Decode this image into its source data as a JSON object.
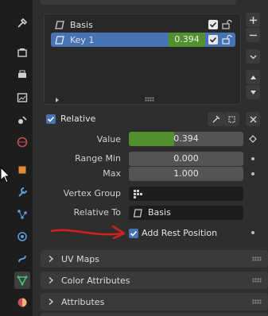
{
  "shape_keys": {
    "items": [
      {
        "name": "Basis",
        "value": "",
        "enabled": true,
        "selected": false
      },
      {
        "name": "Key 1",
        "value": "0.394",
        "enabled": true,
        "selected": true
      }
    ]
  },
  "options": {
    "relative_label": "Relative",
    "relative_checked": true
  },
  "properties": {
    "value_label": "Value",
    "value": "0.394",
    "value_fraction": 0.394,
    "range_min_label": "Range Min",
    "range_min": "0.000",
    "max_label": "Max",
    "max": "1.000",
    "vertex_group_label": "Vertex Group",
    "vertex_group": "",
    "relative_to_label": "Relative To",
    "relative_to": "Basis",
    "add_rest_position_label": "Add Rest Position",
    "add_rest_position_checked": true
  },
  "panels": [
    {
      "label": "UV Maps"
    },
    {
      "label": "Color Attributes"
    },
    {
      "label": "Attributes"
    }
  ],
  "colors": {
    "selection": "#4772b3",
    "value_fill": "#51902c",
    "annotation": "#d02020"
  }
}
